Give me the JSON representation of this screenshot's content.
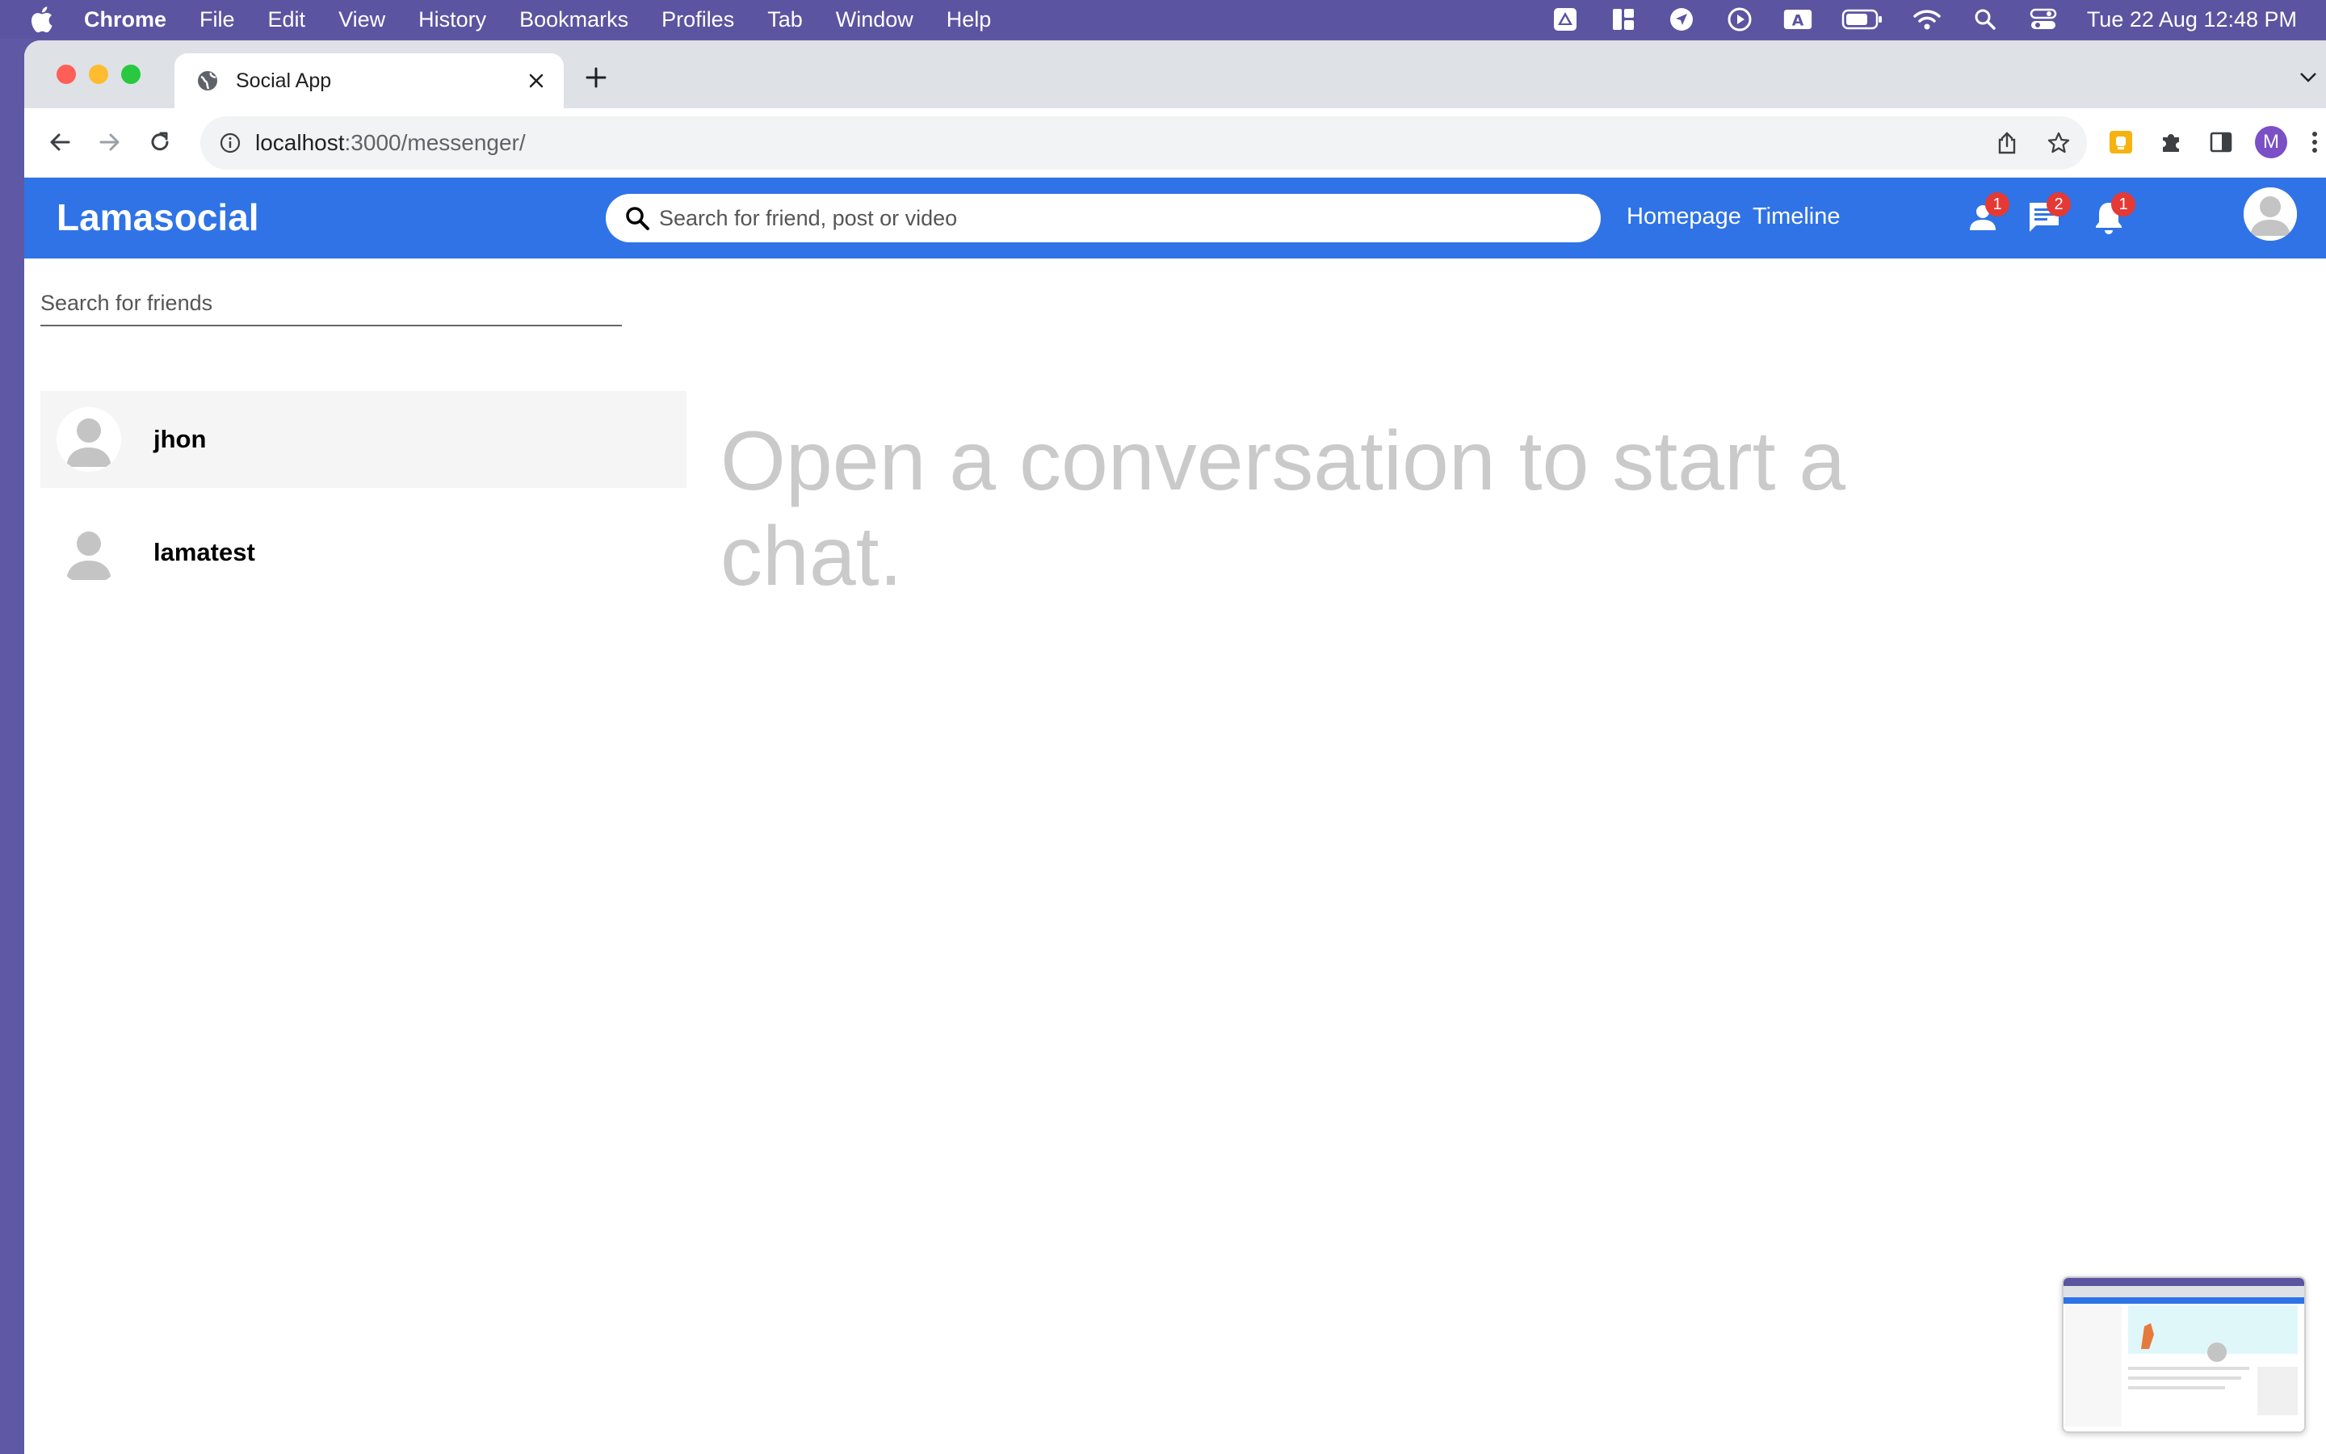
{
  "menubar": {
    "app_name": "Chrome",
    "items": [
      "File",
      "Edit",
      "View",
      "History",
      "Bookmarks",
      "Profiles",
      "Tab",
      "Window",
      "Help"
    ],
    "clock": "Tue 22 Aug  12:48 PM",
    "status_icons": [
      "drive-icon",
      "layout-icon",
      "location-icon",
      "play-icon",
      "keyboard-a-icon",
      "battery-icon",
      "wifi-icon",
      "spotlight-icon",
      "control-center-icon"
    ]
  },
  "browser": {
    "tab_title": "Social App",
    "url_host": "localhost",
    "url_path": ":3000/messenger/",
    "profile_initial": "M"
  },
  "app": {
    "logo": "Lamasocial",
    "search_placeholder": "Search for friend, post or video",
    "links": {
      "home": "Homepage",
      "timeline": "Timeline"
    },
    "badges": {
      "friend_requests": "1",
      "messages": "2",
      "notifications": "1"
    },
    "colors": {
      "topbar": "#2f73e6",
      "badge": "#e53935",
      "placeholder_text": "#cacaca"
    }
  },
  "messenger": {
    "friend_search_placeholder": "Search for friends",
    "friends": [
      {
        "name": "jhon"
      },
      {
        "name": "lamatest"
      }
    ],
    "no_conversation_text": "Open a conversation to start a chat."
  }
}
